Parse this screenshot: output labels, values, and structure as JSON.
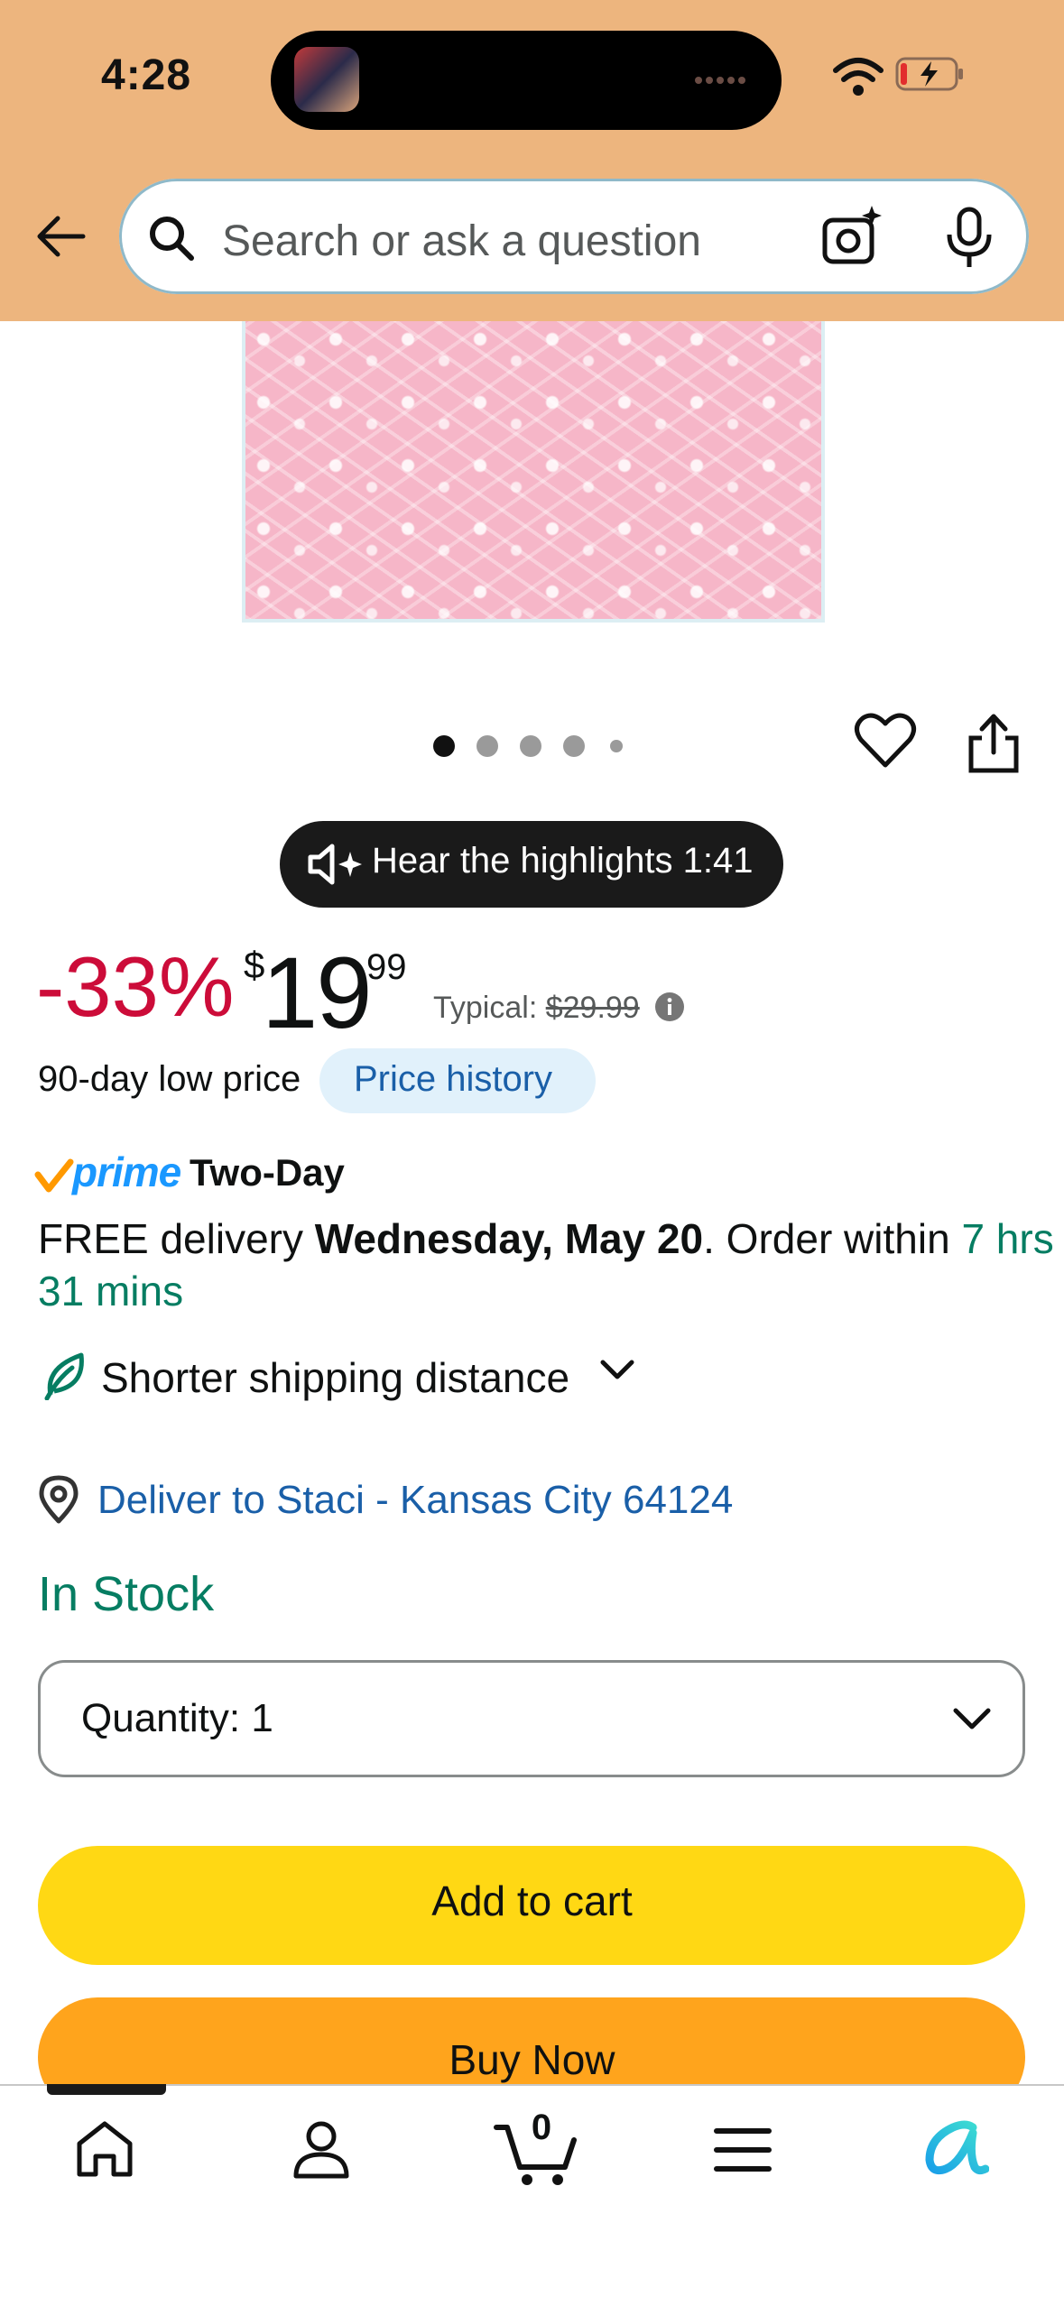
{
  "status_bar": {
    "time": "4:28"
  },
  "search": {
    "placeholder": "Search or ask a question"
  },
  "gallery": {
    "dot_count": 5,
    "active_index": 0
  },
  "audio": {
    "label": "Hear the highlights 1:41"
  },
  "price": {
    "discount": "-33%",
    "currency": "$",
    "whole": "19",
    "fraction": "99",
    "typical_label": "Typical:",
    "typical_value": "$29.99",
    "low_price_text": "90-day low price",
    "history_label": "Price history"
  },
  "delivery": {
    "prime_word": "prime",
    "prime_speed": "Two-Day",
    "free_delivery": "FREE delivery ",
    "date": "Wednesday, May 20",
    "order_within": ". Order within ",
    "time_left_1": "7 hrs",
    "time_left_2": "31 mins",
    "shorter_shipping": "Shorter shipping distance",
    "deliver_to": "Deliver to Staci - Kansas City 64124"
  },
  "stock": {
    "status": "In Stock"
  },
  "quantity": {
    "label": "Quantity:",
    "value": "1"
  },
  "actions": {
    "add_to_cart": "Add to cart",
    "buy_now": "Buy Now"
  },
  "bottom_nav": {
    "cart_count": "0"
  },
  "colors": {
    "header_bg": "#edb57e",
    "discount_red": "#cc0c39",
    "link_blue": "#1a5fa8",
    "stock_green": "#067d62",
    "add_to_cart_yellow": "#ffd814",
    "buy_now_orange": "#ffa41c",
    "prime_blue": "#1a98ff"
  }
}
